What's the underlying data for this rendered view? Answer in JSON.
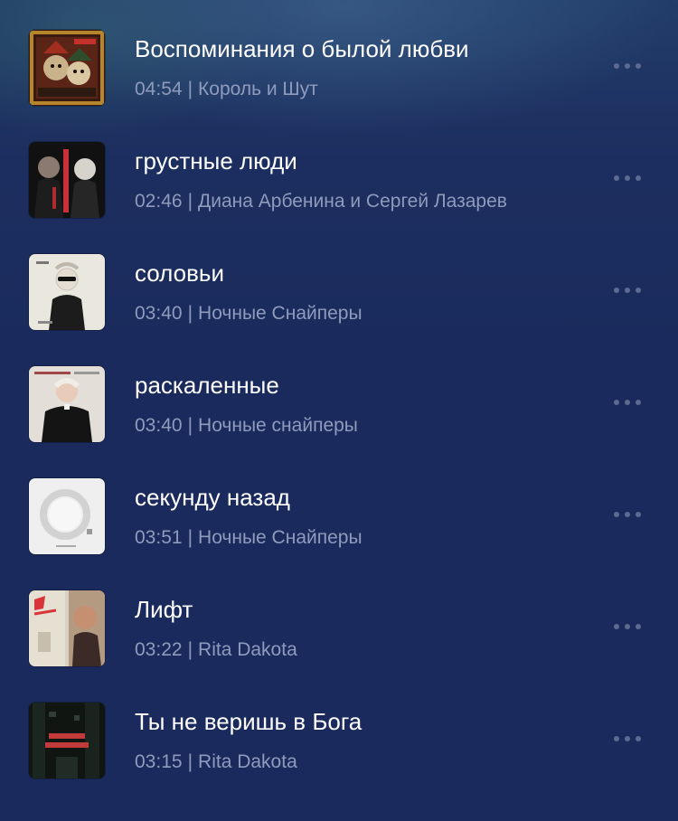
{
  "tracks": [
    {
      "title": "Воспоминания о былой любви",
      "duration": "04:54",
      "separator": "|",
      "artist": "Король и Шут",
      "cover_icon": "album-cover-korol-i-shut"
    },
    {
      "title": "грустные люди",
      "duration": "02:46",
      "separator": "|",
      "artist": "Диана Арбенина и Сергей Лазарев",
      "cover_icon": "album-cover-grustnye-lyudi"
    },
    {
      "title": "соловьи",
      "duration": "03:40",
      "separator": "|",
      "artist": "Ночные Снайперы",
      "cover_icon": "album-cover-solovyi"
    },
    {
      "title": "раскаленные",
      "duration": "03:40",
      "separator": "|",
      "artist": "Ночные снайперы",
      "cover_icon": "album-cover-raskalennye"
    },
    {
      "title": "секунду назад",
      "duration": "03:51",
      "separator": "|",
      "artist": "Ночные Снайперы",
      "cover_icon": "album-cover-sekundu-nazad"
    },
    {
      "title": "Лифт",
      "duration": "03:22",
      "separator": "|",
      "artist": "Rita Dakota",
      "cover_icon": "album-cover-lift"
    },
    {
      "title": "Ты не веришь в Бога",
      "duration": "03:15",
      "separator": "|",
      "artist": "Rita Dakota",
      "cover_icon": "album-cover-ty-ne-verish-v-boga"
    }
  ],
  "more_icon": "more-horizontal-icon",
  "colors": {
    "background": "#1a2a5c",
    "title_text": "#ffffff",
    "meta_text": "#8f9bbd",
    "more_dots": "#5d6a92"
  }
}
